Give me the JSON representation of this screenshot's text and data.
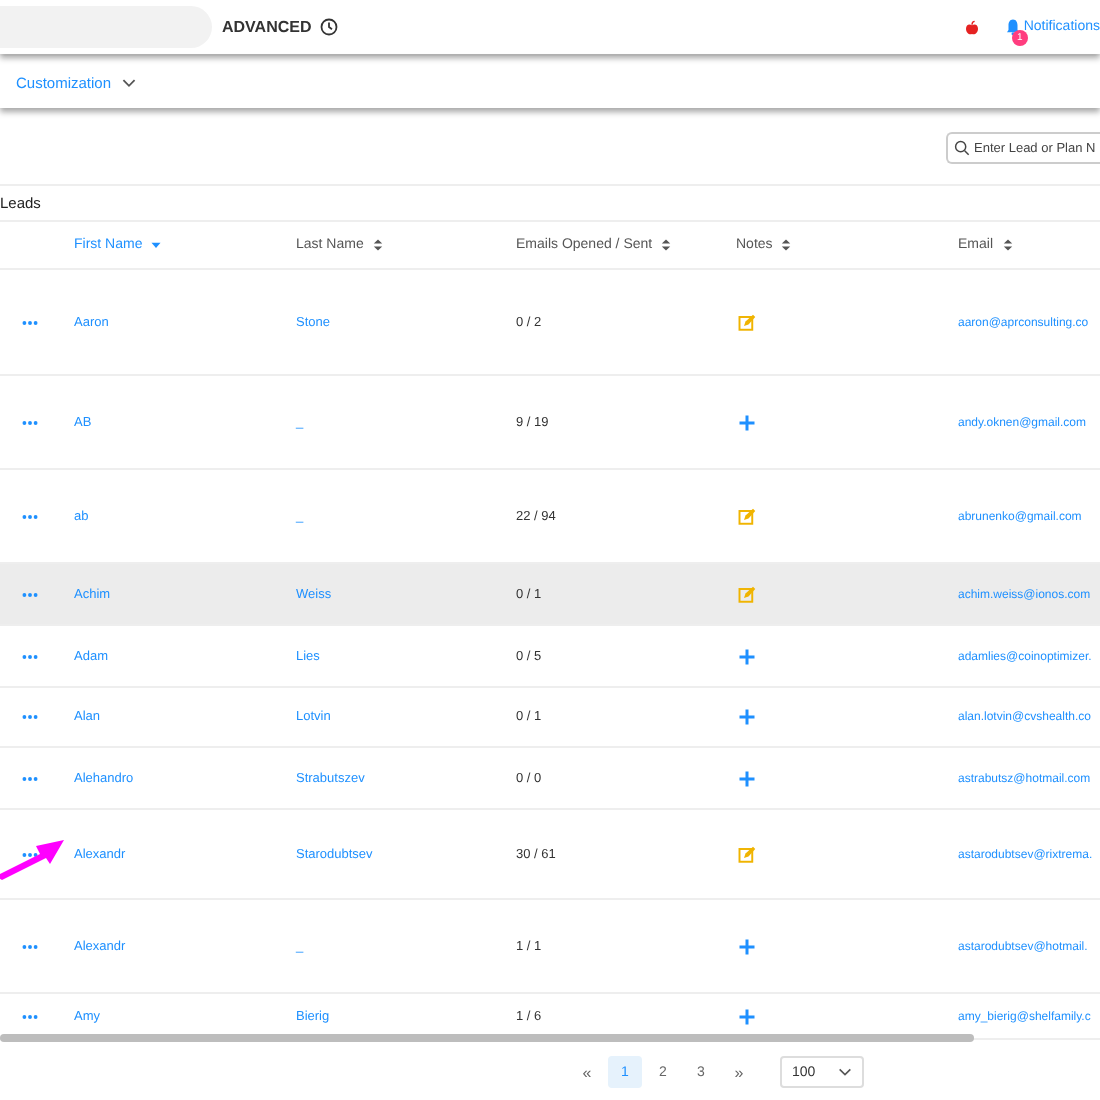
{
  "topbar": {
    "mode": "ADVANCED",
    "notifications": {
      "label": "Notifications",
      "badge": "1"
    }
  },
  "subnav": {
    "label": "Customization"
  },
  "search": {
    "placeholder": "Enter Lead or Plan N"
  },
  "section_title": "Leads",
  "table": {
    "columns": [
      {
        "label": "First Name",
        "sorted": true
      },
      {
        "label": "Last Name",
        "sorted": false
      },
      {
        "label": "Emails Opened / Sent",
        "sorted": false
      },
      {
        "label": "Notes",
        "sorted": false
      },
      {
        "label": "Email",
        "sorted": false
      }
    ],
    "rows": [
      {
        "first": "Aaron",
        "last": "Stone",
        "emails": "0 / 2",
        "kind": "edit",
        "email": "aaron@aprconsulting.co",
        "highlighted": false
      },
      {
        "first": "AB",
        "last": "_",
        "emails": "9 / 19",
        "kind": "add",
        "email": "andy.oknen@gmail.com",
        "highlighted": false
      },
      {
        "first": "ab",
        "last": "_",
        "emails": "22 / 94",
        "kind": "edit",
        "email": "abrunenko@gmail.com",
        "highlighted": false
      },
      {
        "first": "Achim",
        "last": "Weiss",
        "emails": "0 / 1",
        "kind": "edit",
        "email": "achim.weiss@ionos.com",
        "highlighted": true
      },
      {
        "first": "Adam",
        "last": "Lies",
        "emails": "0 / 5",
        "kind": "add",
        "email": "adamlies@coinoptimizer.",
        "highlighted": false
      },
      {
        "first": "Alan",
        "last": "Lotvin",
        "emails": "0 / 1",
        "kind": "add",
        "email": "alan.lotvin@cvshealth.co",
        "highlighted": false
      },
      {
        "first": "Alehandro",
        "last": "Strabutszev",
        "emails": "0 / 0",
        "kind": "add",
        "email": "astrabutsz@hotmail.com",
        "highlighted": false
      },
      {
        "first": "Alexandr",
        "last": "Starodubtsev",
        "emails": "30 / 61",
        "kind": "edit",
        "email": "astarodubtsev@rixtrema.",
        "highlighted": false
      },
      {
        "first": "Alexandr",
        "last": "_",
        "emails": "1 / 1",
        "kind": "add",
        "email": "astarodubtsev@hotmail.",
        "highlighted": false
      },
      {
        "first": "Amy",
        "last": "Bierig",
        "emails": "1 / 6",
        "kind": "add",
        "email": "amy_bierig@shelfamily.c",
        "highlighted": false
      }
    ]
  },
  "pagination": {
    "first": "«",
    "pages": [
      {
        "label": "1",
        "selected": true
      },
      {
        "label": "2",
        "selected": false
      },
      {
        "label": "3",
        "selected": false
      }
    ],
    "last": "»",
    "page_size": "100"
  }
}
